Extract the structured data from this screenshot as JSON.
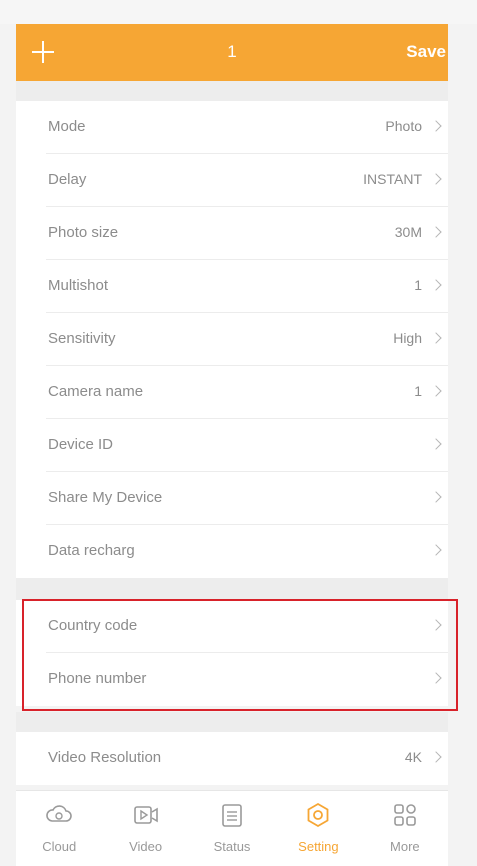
{
  "header": {
    "title": "1",
    "save_label": "Save"
  },
  "settings_group_1": [
    {
      "label": "Mode",
      "value": "Photo"
    },
    {
      "label": "Delay",
      "value": "INSTANT"
    },
    {
      "label": "Photo size",
      "value": "30M"
    },
    {
      "label": "Multishot",
      "value": "1"
    },
    {
      "label": "Sensitivity",
      "value": "High"
    },
    {
      "label": "Camera name",
      "value": "1"
    },
    {
      "label": "Device ID",
      "value": ""
    },
    {
      "label": "Share My Device",
      "value": ""
    },
    {
      "label": "Data recharg",
      "value": ""
    }
  ],
  "settings_group_2": [
    {
      "label": "Country code",
      "value": ""
    },
    {
      "label": "Phone number",
      "value": ""
    }
  ],
  "settings_group_3": [
    {
      "label": "Video Resolution",
      "value": "4K"
    }
  ],
  "tabs": [
    {
      "label": "Cloud",
      "icon": "cloud-icon",
      "active": false
    },
    {
      "label": "Video",
      "icon": "video-icon",
      "active": false
    },
    {
      "label": "Status",
      "icon": "status-icon",
      "active": false
    },
    {
      "label": "Setting",
      "icon": "gear-icon",
      "active": true
    },
    {
      "label": "More",
      "icon": "grid-icon",
      "active": false
    }
  ],
  "colors": {
    "accent": "#f6a634",
    "highlight_border": "#d8222a"
  }
}
